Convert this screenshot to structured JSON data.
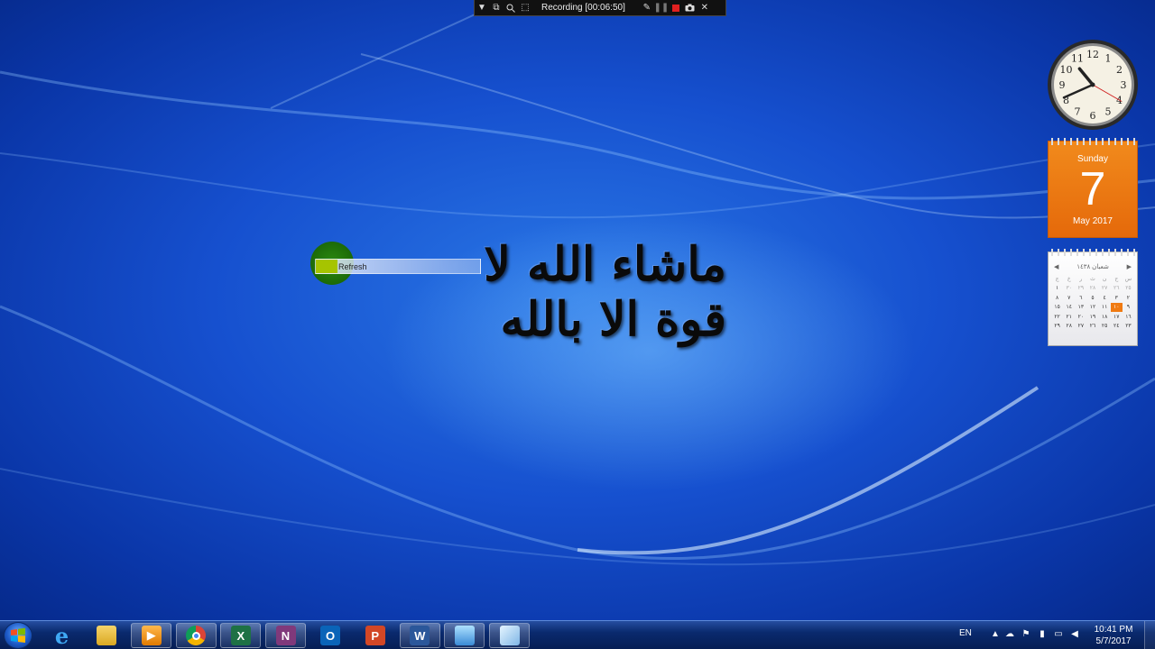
{
  "recording_toolbar": {
    "label": "Recording [00:06:50]"
  },
  "desktop": {
    "calligraphy_text": "ماشاء الله لا قوة الا بالله",
    "context_item_label": "Refresh"
  },
  "gadgets": {
    "clock": {
      "hour": 10,
      "minute": 41,
      "second": 20,
      "numbers": [
        "12",
        "1",
        "2",
        "3",
        "4",
        "5",
        "6",
        "7",
        "8",
        "9",
        "10",
        "11"
      ]
    },
    "date": {
      "day_of_week": "Sunday",
      "day": "7",
      "month_year": "May 2017"
    },
    "month_calendar": {
      "title": "شعبان ١٤٣٨",
      "prev": "◀",
      "next": "▶",
      "weekday_headers": [
        "ج",
        "خ",
        "ر",
        "ث",
        "ن",
        "ح",
        "س"
      ],
      "rows": [
        [
          "١",
          "٣٠",
          "٢٩",
          "٢٨",
          "٢٧",
          "٢٦",
          "٢٥"
        ],
        [
          "٨",
          "٧",
          "٦",
          "٥",
          "٤",
          "٣",
          "٢"
        ],
        [
          "١٥",
          "١٤",
          "١٣",
          "١٢",
          "١١",
          "١٠",
          "٩"
        ],
        [
          "٢٢",
          "٢١",
          "٢٠",
          "١٩",
          "١٨",
          "١٧",
          "١٦"
        ],
        [
          "٢٩",
          "٢٨",
          "٢٧",
          "٢٦",
          "٢٥",
          "٢٤",
          "٢٣"
        ]
      ],
      "today": "١٠"
    }
  },
  "taskbar": {
    "items": [
      {
        "name": "internet-explorer",
        "glyph": "e"
      },
      {
        "name": "file-explorer",
        "glyph": ""
      },
      {
        "name": "media-player",
        "glyph": "▶"
      },
      {
        "name": "chrome",
        "glyph": ""
      },
      {
        "name": "excel",
        "glyph": "X"
      },
      {
        "name": "onenote",
        "glyph": "N"
      },
      {
        "name": "outlook",
        "glyph": "O"
      },
      {
        "name": "powerpoint",
        "glyph": "P"
      },
      {
        "name": "word",
        "glyph": "W"
      },
      {
        "name": "remote-desktop",
        "glyph": ""
      },
      {
        "name": "snipping-tool",
        "glyph": ""
      }
    ],
    "tray": {
      "language": "EN",
      "time": "10:41 PM",
      "date": "5/7/2017"
    }
  }
}
